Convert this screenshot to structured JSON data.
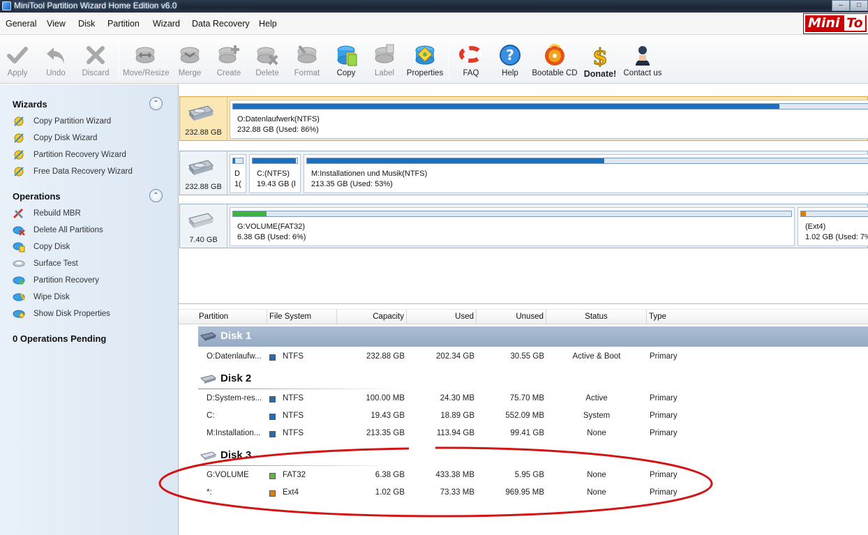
{
  "window": {
    "title": "MiniTool Partition Wizard Home Edition v6.0",
    "controls": [
      "–",
      "□"
    ]
  },
  "brand": {
    "part1": "Mini",
    "part2": "To"
  },
  "menu": [
    "General",
    "View",
    "Disk",
    "Partition",
    "Wizard",
    "Data Recovery",
    "Help"
  ],
  "toolbar": {
    "apply": "Apply",
    "undo": "Undo",
    "discard": "Discard",
    "move_resize": "Move/Resize",
    "merge": "Merge",
    "create": "Create",
    "delete": "Delete",
    "format": "Format",
    "copy": "Copy",
    "label": "Label",
    "properties": "Properties",
    "faq": "FAQ",
    "help": "Help",
    "bootable_cd": "Bootable CD",
    "donate": "Donate!",
    "contact": "Contact us"
  },
  "sidebar": {
    "wizards_title": "Wizards",
    "wizards": [
      "Copy Partition Wizard",
      "Copy Disk Wizard",
      "Partition Recovery Wizard",
      "Free Data Recovery Wizard"
    ],
    "operations_title": "Operations",
    "operations": [
      "Rebuild MBR",
      "Delete All Partitions",
      "Copy Disk",
      "Surface Test",
      "Partition Recovery",
      "Wipe Disk",
      "Show Disk Properties"
    ],
    "pending": "0 Operations Pending"
  },
  "diskmap": [
    {
      "size": "232.88 GB",
      "partitions": [
        {
          "line1": "O:Datenlaufwerk(NTFS)",
          "line2": "232.88 GB (Used: 86%)",
          "color": "#1c6fc0",
          "used_pct": 86
        }
      ]
    },
    {
      "size": "232.88 GB",
      "partitions": [
        {
          "line1": "D",
          "line2": "1(",
          "color": "#1c6fc0",
          "used_pct": 24
        },
        {
          "line1": "C:(NTFS)",
          "line2": "19.43 GB (l",
          "color": "#1c6fc0",
          "used_pct": 97
        },
        {
          "line1": "M:Installationen und Musik(NTFS)",
          "line2": "213.35 GB (Used: 53%)",
          "color": "#1c6fc0",
          "used_pct": 53
        }
      ]
    },
    {
      "size": "7.40 GB",
      "partitions": [
        {
          "line1": "G:VOLUME(FAT32)",
          "line2": "6.38 GB (Used: 6%)",
          "color": "#3db43d",
          "used_pct": 6
        },
        {
          "line1": "(Ext4)",
          "line2": "1.02 GB (Used: 7%",
          "color": "#d97f0c",
          "used_pct": 7
        }
      ]
    }
  ],
  "columns": [
    "Partition",
    "File System",
    "Capacity",
    "Used",
    "Unused",
    "Status",
    "Type"
  ],
  "disks": [
    {
      "label": "Disk 1",
      "rows": [
        {
          "partition": "O:Datenlaufw...",
          "fs": "NTFS",
          "color": "#1c6fc0",
          "capacity": "232.88 GB",
          "used": "202.34 GB",
          "unused": "30.55 GB",
          "status": "Active & Boot",
          "type": "Primary"
        }
      ]
    },
    {
      "label": "Disk 2",
      "rows": [
        {
          "partition": "D:System-res...",
          "fs": "NTFS",
          "color": "#1c6fc0",
          "capacity": "100.00 MB",
          "used": "24.30 MB",
          "unused": "75.70 MB",
          "status": "Active",
          "type": "Primary"
        },
        {
          "partition": "C:",
          "fs": "NTFS",
          "color": "#1c6fc0",
          "capacity": "19.43 GB",
          "used": "18.89 GB",
          "unused": "552.09 MB",
          "status": "System",
          "type": "Primary"
        },
        {
          "partition": "M:Installation...",
          "fs": "NTFS",
          "color": "#1c6fc0",
          "capacity": "213.35 GB",
          "used": "113.94 GB",
          "unused": "99.41 GB",
          "status": "None",
          "type": "Primary"
        }
      ]
    },
    {
      "label": "Disk 3",
      "rows": [
        {
          "partition": "G:VOLUME",
          "fs": "FAT32",
          "color": "#5dbb3a",
          "capacity": "6.38 GB",
          "used": "433.38 MB",
          "unused": "5.95 GB",
          "status": "None",
          "type": "Primary"
        },
        {
          "partition": "*:",
          "fs": "Ext4",
          "color": "#d97f0c",
          "capacity": "1.02 GB",
          "used": "73.33 MB",
          "unused": "969.95 MB",
          "status": "None",
          "type": "Primary"
        }
      ]
    }
  ]
}
